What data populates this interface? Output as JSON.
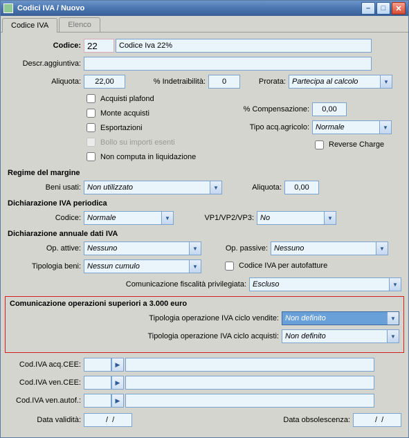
{
  "window": {
    "title": "Codici IVA / Nuovo"
  },
  "tabs": {
    "active": "Codice IVA",
    "inactive": "Elenco"
  },
  "fields": {
    "codice_label": "Codice:",
    "codice_value": "22",
    "codice_desc": "Codice Iva 22%",
    "descr_agg_label": "Descr.aggiuntiva:",
    "descr_agg_value": "",
    "aliquota_label": "Aliquota:",
    "aliquota_value": "22,00",
    "indetr_label": "% Indetraibilità:",
    "indetr_value": "0",
    "prorata_label": "Prorata:",
    "prorata_value": "Partecipa al calcolo",
    "chk_plafond": "Acquisti plafond",
    "chk_monte": "Monte acquisti",
    "chk_esport": "Esportazioni",
    "chk_bollo": "Bollo su importi esenti",
    "chk_noncomp": "Non computa in liquidazione",
    "compens_label": "% Compensazione:",
    "compens_value": "0,00",
    "tipoagr_label": "Tipo acq.agricolo:",
    "tipoagr_value": "Normale",
    "chk_reverse": "Reverse Charge",
    "sec_regime": "Regime del margine",
    "beniusati_label": "Beni usati:",
    "beniusati_value": "Non utilizzato",
    "aliquota2_label": "Aliquota:",
    "aliquota2_value": "0,00",
    "sec_periodica": "Dichiarazione IVA periodica",
    "codice2_label": "Codice:",
    "codice2_value": "Normale",
    "vp_label": "VP1/VP2/VP3:",
    "vp_value": "No",
    "sec_annuale": "Dichiarazione annuale dati IVA",
    "opattive_label": "Op. attive:",
    "opattive_value": "Nessuno",
    "oppassive_label": "Op. passive:",
    "oppassive_value": "Nessuno",
    "tipobeni_label": "Tipologia beni:",
    "tipobeni_value": "Nessun cumulo",
    "chk_autofatture": "Codice IVA per autofatture",
    "fiscpriv_label": "Comunicazione fiscalità privilegiata:",
    "fiscpriv_value": "Escluso",
    "sec_3000": "Comunicazione operazioni superiori a 3.000 euro",
    "tipovend_label": "Tipologia operazione IVA ciclo vendite:",
    "tipovend_value": "Non definito",
    "tipoacq_label": "Tipologia operazione IVA ciclo acquisti:",
    "tipoacq_value": "Non definito",
    "codacqcee_label": "Cod.IVA acq.CEE:",
    "codvencee_label": "Cod.IVA ven.CEE:",
    "codvenautof_label": "Cod.IVA ven.autof.:",
    "datavalid_label": "Data validità:",
    "datavalid_value": "  /  /",
    "dataobs_label": "Data obsolescenza:",
    "dataobs_value": "  /  /"
  }
}
